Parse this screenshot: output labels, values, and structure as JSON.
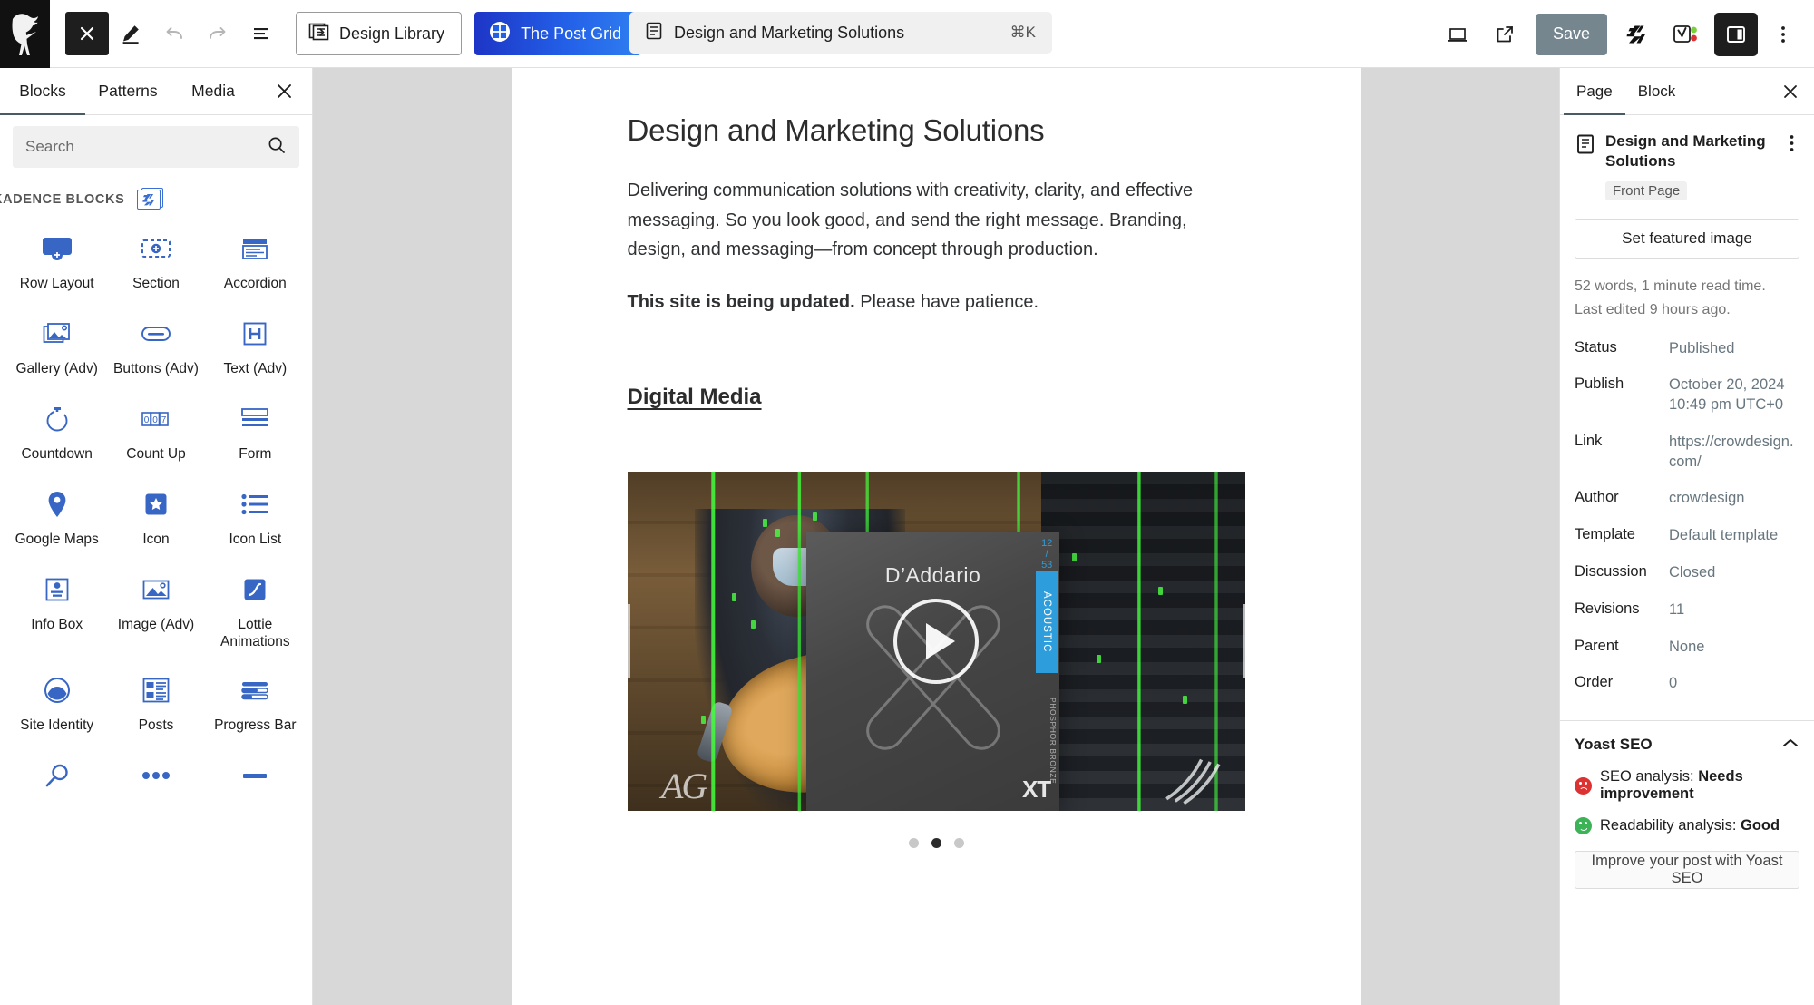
{
  "topbar": {
    "close_label": "✕",
    "tools_icon": "pencil-tools-icon",
    "undo_icon": "undo-icon",
    "redo_icon": "redo-icon",
    "list_view_icon": "list-view-icon",
    "design_library_label": "Design Library",
    "post_grid_label": "The Post Grid",
    "document_title": "Design and Marketing Solutions",
    "command_shortcut": "⌘K",
    "view_icon": "desktop-view-icon",
    "preview_icon": "external-link-icon",
    "save_label": "Save",
    "kadence_icon": "kadence-icon",
    "yoast_icon": "yoast-seo-icon",
    "settings_toggle_icon": "settings-panel-icon",
    "options_icon": "more-options-icon"
  },
  "inserter": {
    "tabs": [
      {
        "label": "Blocks",
        "active": true
      },
      {
        "label": "Patterns",
        "active": false
      },
      {
        "label": "Media",
        "active": false
      }
    ],
    "close_label": "✕",
    "search_placeholder": "Search",
    "search_value": "",
    "group_title": "KADENCE BLOCKS",
    "blocks": [
      {
        "label": "Row Layout",
        "icon": "row-layout-icon"
      },
      {
        "label": "Section",
        "icon": "section-icon"
      },
      {
        "label": "Accordion",
        "icon": "accordion-icon"
      },
      {
        "label": "Gallery (Adv)",
        "icon": "gallery-icon"
      },
      {
        "label": "Buttons (Adv)",
        "icon": "buttons-icon"
      },
      {
        "label": "Text (Adv)",
        "icon": "text-heading-icon"
      },
      {
        "label": "Countdown",
        "icon": "countdown-icon"
      },
      {
        "label": "Count Up",
        "icon": "count-up-icon"
      },
      {
        "label": "Form",
        "icon": "form-icon"
      },
      {
        "label": "Google Maps",
        "icon": "map-pin-icon"
      },
      {
        "label": "Icon",
        "icon": "star-icon"
      },
      {
        "label": "Icon List",
        "icon": "icon-list-icon"
      },
      {
        "label": "Info Box",
        "icon": "info-box-icon"
      },
      {
        "label": "Image (Adv)",
        "icon": "image-icon"
      },
      {
        "label": "Lottie Animations",
        "icon": "lottie-icon"
      },
      {
        "label": "Site Identity",
        "icon": "site-identity-icon"
      },
      {
        "label": "Posts",
        "icon": "posts-icon"
      },
      {
        "label": "Progress Bar",
        "icon": "progress-bar-icon"
      },
      {
        "label": "",
        "icon": "search-magnifier-icon"
      },
      {
        "label": "",
        "icon": "dots-icon"
      },
      {
        "label": "",
        "icon": "divider-icon"
      }
    ]
  },
  "canvas": {
    "title": "Design and Marketing Solutions",
    "paragraph_1": "Delivering communication solutions with creativity, clarity, and effective messaging. So you look good, and send the right message. Branding, design, and messaging—from concept through production.",
    "notice_bold": "This site is being updated.",
    "notice_rest": " Please have patience.",
    "section_heading": "Digital Media",
    "slide": {
      "brand": "D’Addario",
      "gauge_top": "12",
      "gauge_bottom": "53",
      "side_label": "ACOUSTIC",
      "material_label": "PHOSPHOR BRONZE",
      "product_code": "XT",
      "watermark": "AG",
      "play_label": "play-video"
    },
    "carousel": {
      "prev_label": "‹",
      "next_label": "›",
      "dots": [
        {
          "active": false
        },
        {
          "active": true
        },
        {
          "active": false
        }
      ]
    }
  },
  "settings": {
    "tabs": [
      {
        "label": "Page",
        "active": true
      },
      {
        "label": "Block",
        "active": false
      }
    ],
    "close_label": "✕",
    "page_title": "Design and Marketing Solutions",
    "page_badge": "Front Page",
    "featured_image_label": "Set featured image",
    "word_count_note": "52 words, 1 minute read time.",
    "last_edited_note": "Last edited 9 hours ago.",
    "meta": [
      {
        "key": "Status",
        "value": "Published"
      },
      {
        "key": "Publish",
        "value": "October 20, 2024 10:49 pm UTC+0"
      },
      {
        "key": "Link",
        "value": "https://crowdesign.com/"
      },
      {
        "key": "Author",
        "value": "crowdesign"
      },
      {
        "key": "Template",
        "value": "Default template"
      },
      {
        "key": "Discussion",
        "value": "Closed"
      },
      {
        "key": "Revisions",
        "value": "11"
      },
      {
        "key": "Parent",
        "value": "None"
      },
      {
        "key": "Order",
        "value": "0"
      }
    ],
    "yoast": {
      "title": "Yoast SEO",
      "seo_label": "SEO analysis: ",
      "seo_value": "Needs improvement",
      "readability_label": "Readability analysis: ",
      "readability_value": "Good",
      "cta_label": "Improve your post with Yoast SEO"
    }
  },
  "colors": {
    "accent_blue": "#2360e8",
    "kadence_blue": "#3b6fd4",
    "save_gray": "#76868f",
    "seo_bad": "#dc3232",
    "seo_good": "#3db358"
  }
}
